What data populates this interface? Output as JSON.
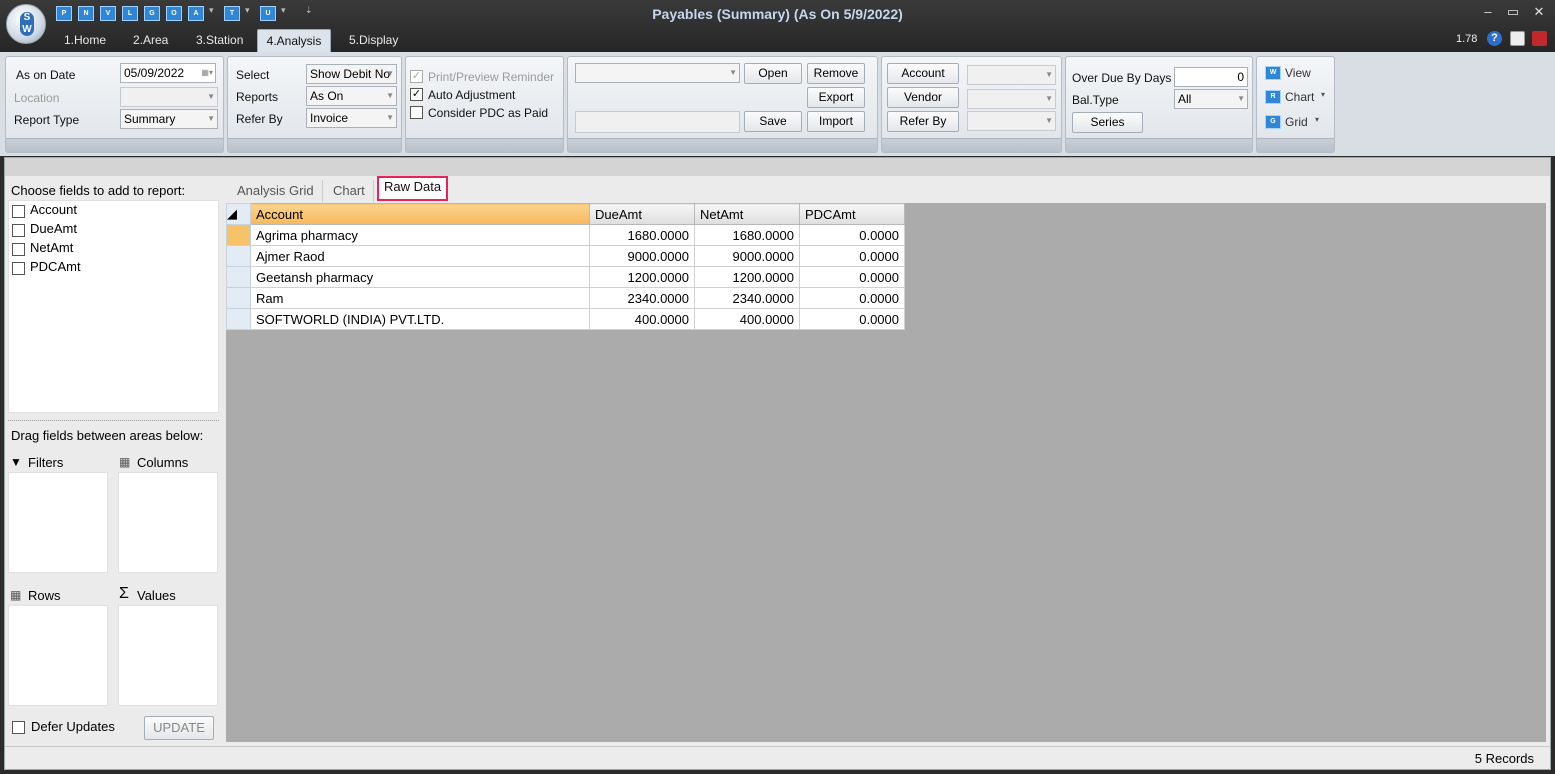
{
  "window": {
    "title": "Payables (Summary) (As On 5/9/2022)",
    "version": "1.78",
    "qat": [
      "P",
      "N",
      "V",
      "L",
      "G",
      "O",
      "A",
      "T",
      "U"
    ],
    "menu_tabs": [
      "1.Home",
      "2.Area",
      "3.Station",
      "4.Analysis",
      "5.Display"
    ],
    "active_tab": "4.Analysis"
  },
  "ribbon": {
    "as_on_date_label": "As on Date",
    "as_on_date_value": "05/09/2022",
    "location_label": "Location",
    "report_type_label": "Report Type",
    "report_type_value": "Summary",
    "select_label": "Select",
    "select_value": "Show Debit No",
    "reports_label": "Reports",
    "reports_value": "As On",
    "refer_by_label": "Refer By",
    "refer_by_value": "Invoice",
    "print_preview_reminder": "Print/Preview Reminder",
    "auto_adjustment": "Auto Adjustment",
    "consider_pdc": "Consider PDC as Paid",
    "open": "Open",
    "remove": "Remove",
    "export": "Export",
    "save": "Save",
    "import": "Import",
    "account": "Account",
    "vendor": "Vendor",
    "refer_by_btn": "Refer By",
    "over_due_label": "Over Due By Days",
    "over_due_value": "0",
    "bal_type_label": "Bal.Type",
    "bal_type_value": "All",
    "series": "Series",
    "view": "View",
    "chart": "Chart",
    "grid": "Grid",
    "view_icon": "W",
    "chart_icon": "R",
    "grid_icon": "G"
  },
  "field_list": {
    "title": "Choose fields to add to report:",
    "fields": [
      "Account",
      "DueAmt",
      "NetAmt",
      "PDCAmt"
    ],
    "drag_title": "Drag fields between areas below:",
    "filters": "Filters",
    "columns": "Columns",
    "rows": "Rows",
    "values": "Values",
    "defer_updates": "Defer Updates",
    "update": "UPDATE"
  },
  "tabs": [
    "Analysis Grid",
    "Chart",
    "Raw Data"
  ],
  "grid": {
    "columns": [
      "Account",
      "DueAmt",
      "NetAmt",
      "PDCAmt"
    ],
    "rows": [
      [
        "Agrima pharmacy",
        "1680.0000",
        "1680.0000",
        "0.0000"
      ],
      [
        "Ajmer Raod",
        "9000.0000",
        "9000.0000",
        "0.0000"
      ],
      [
        "Geetansh pharmacy",
        "1200.0000",
        "1200.0000",
        "0.0000"
      ],
      [
        "Ram",
        "2340.0000",
        "2340.0000",
        "0.0000"
      ],
      [
        "SOFTWORLD (INDIA) PVT.LTD.",
        "400.0000",
        "400.0000",
        "0.0000"
      ]
    ]
  },
  "status": "5 Records"
}
